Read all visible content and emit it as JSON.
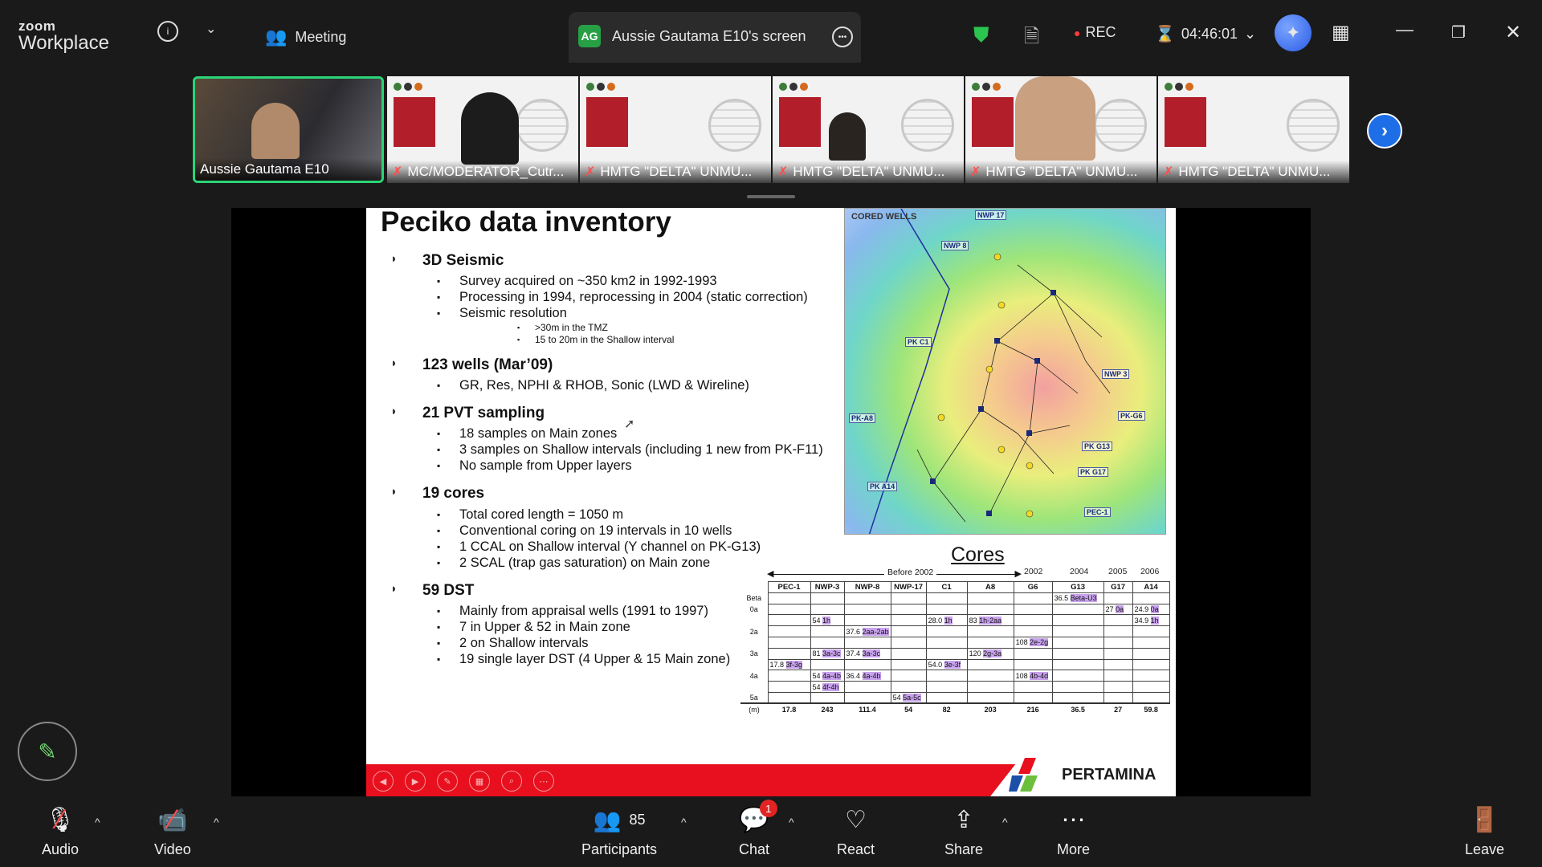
{
  "app": {
    "logo_top": "zoom",
    "logo_bottom": "Workplace"
  },
  "topbar": {
    "meeting_label": "Meeting",
    "screen_tab": {
      "initials": "AG",
      "label": "Aussie Gautama E10's screen"
    },
    "rec_label": "REC",
    "timer": "04:46:01"
  },
  "thumbnails": [
    {
      "name": "Aussie Gautama E10"
    },
    {
      "name": "MC/MODERATOR_Cutr..."
    },
    {
      "name": "HMTG \"DELTA\" UNMU..."
    },
    {
      "name": "HMTG \"DELTA\" UNMU..."
    },
    {
      "name": "HMTG \"DELTA\" UNMU..."
    },
    {
      "name": "HMTG \"DELTA\" UNMU..."
    }
  ],
  "slide": {
    "title": "Peciko data inventory",
    "sections": [
      {
        "heading": "3D Seismic",
        "items": [
          "Survey acquired on ~350 km2 in 1992-1993",
          "Processing in 1994, reprocessing in 2004 (static correction)",
          "Seismic resolution"
        ],
        "subitems": [
          ">30m in the TMZ",
          "15 to 20m in the Shallow interval"
        ]
      },
      {
        "heading": "123 wells (Mar’09)",
        "items": [
          "GR, Res, NPHI & RHOB, Sonic (LWD & Wireline)"
        ]
      },
      {
        "heading": "21 PVT sampling",
        "items": [
          "18 samples on Main zones",
          "3 samples on Shallow intervals (including 1 new from PK-F11)",
          "No sample from Upper layers"
        ]
      },
      {
        "heading": "19 cores",
        "items": [
          "Total cored length = 1050 m",
          "Conventional coring on 19 intervals in 10 wells",
          "1 CCAL on Shallow interval (Y channel on PK-G13)",
          "2 SCAL (trap gas saturation) on Main zone"
        ]
      },
      {
        "heading": "59 DST",
        "items": [
          "Mainly from appraisal wells (1991 to 1997)",
          "7 in Upper & 52 in Main zone",
          "2 on Shallow intervals",
          "19 single layer DST (4 Upper & 15 Main zone)"
        ]
      }
    ],
    "map": {
      "legend": "CORED WELLS",
      "labels": [
        "NWP 17",
        "NWP 8",
        "PK C1",
        "NWP 3",
        "PK-A8",
        "PK-G6",
        "PK G13",
        "PK G17",
        "PK A14",
        "PEC-1"
      ]
    },
    "cores": {
      "title": "Cores",
      "before_label": "Before 2002",
      "years": [
        "2002",
        "2004",
        "2005",
        "2006"
      ],
      "columns": [
        "PEC-1",
        "NWP-3",
        "NWP-8",
        "NWP-17",
        "C1",
        "A8",
        "G6",
        "G13",
        "G17",
        "A14"
      ],
      "row_labels": [
        "Beta",
        "0a",
        "",
        "2a",
        "",
        "3a",
        "",
        "4a",
        "",
        "5a"
      ],
      "cells": {
        "g13_beta": "36.5",
        "g13_beta_hl": "Beta-U3",
        "g17_0a": "27",
        "g17_0a_hl": "0a",
        "a14_0a": "24.9",
        "a14_0a_hl": "0a",
        "a14_1h": "34.9",
        "a14_1h_hl": "1h",
        "nwp3_1h": "54",
        "nwp3_1h_hl": "1h",
        "c1_1h": "28.0",
        "c1_1h_hl": "1h",
        "a8_1h": "83",
        "a8_1h_hl": "1h-2aa",
        "nwp8_2a": "37.6",
        "nwp8_2a_hl": "2aa-2ab",
        "g6_2e": "108",
        "g6_2e_hl": "2e-2g",
        "nwp3_3a": "81",
        "nwp3_3a_hl": "3a-3c",
        "nwp8_3a": "37.4",
        "nwp8_3a_hl": "3a-3c",
        "a8_2g": "120",
        "a8_2g_hl": "2g-3a",
        "pec1_3f": "17.8",
        "pec1_3f_hl": "3f-3g",
        "c1_3e": "54.0",
        "c1_3e_hl": "3e-3f",
        "nwp3_4a": "54",
        "nwp3_4a_hl": "4a-4b",
        "nwp8_4a": "36.4",
        "nwp8_4a_hl": "4a-4b",
        "g6_4b": "108",
        "g6_4b_hl": "4b-4d",
        "nwp3_4f": "54",
        "nwp3_4f_hl": "4f-4h",
        "nwp17_5a": "54",
        "nwp17_5a_hl": "5a-5c"
      },
      "unit_label": "(m)",
      "totals": [
        "17.8",
        "243",
        "111.4",
        "54",
        "82",
        "203",
        "216",
        "36.5",
        "27",
        "59.8"
      ]
    },
    "brand": "PERTAMINA"
  },
  "bottombar": {
    "audio": "Audio",
    "video": "Video",
    "participants": "Participants",
    "participants_count": "85",
    "chat": "Chat",
    "chat_badge": "1",
    "react": "React",
    "share": "Share",
    "more": "More",
    "leave": "Leave"
  },
  "colors": {
    "accent": "#1e6ee8",
    "active_border": "#2bd476",
    "slide_red": "#e8101e",
    "highlight": "#c9a2ee"
  }
}
